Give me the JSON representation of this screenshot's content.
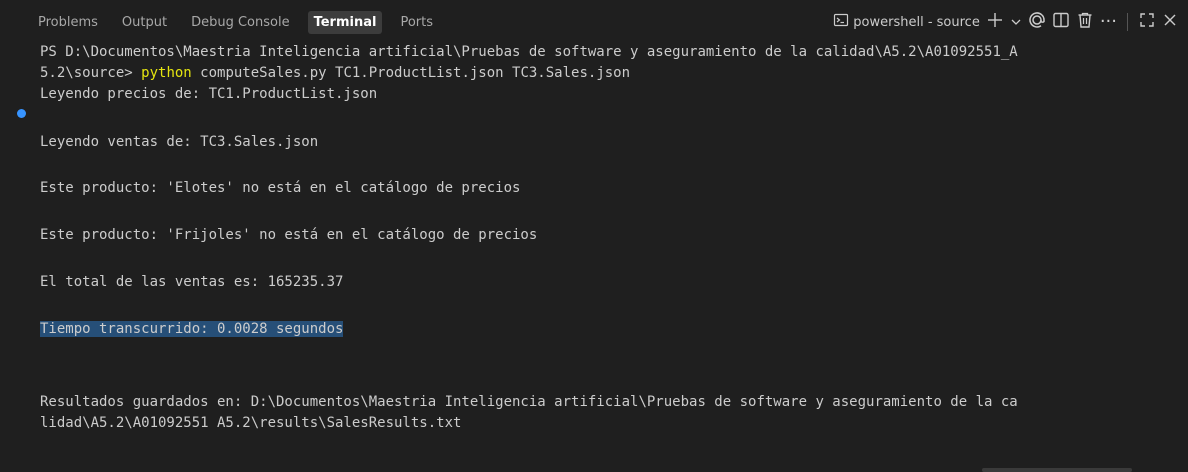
{
  "tabs": [
    {
      "label": "Problems",
      "active": false
    },
    {
      "label": "Output",
      "active": false
    },
    {
      "label": "Debug Console",
      "active": false
    },
    {
      "label": "Terminal",
      "active": true
    },
    {
      "label": "Ports",
      "active": false
    }
  ],
  "toolbar": {
    "terminal_name": "powershell - source",
    "ellipsis": "···",
    "icons": [
      "terminal-icon",
      "plus-icon",
      "chevron-down-icon",
      "copilot-icon",
      "split-icon",
      "trash-icon",
      "more-icon",
      "maximize-icon",
      "close-icon"
    ]
  },
  "terminal": {
    "prompt_line1": "PS D:\\Documentos\\Maestria Inteligencia artificial\\Pruebas de software y aseguramiento de la calidad\\A5.2\\A01092551_A",
    "prompt_line2_prefix": "5.2\\source> ",
    "command_word": "python",
    "command_args": " computeSales.py TC1.ProductList.json TC3.Sales.json",
    "out_prices": "Leyendo precios de: TC1.ProductList.json",
    "out_sales": "Leyendo ventas de: TC3.Sales.json",
    "out_missing1": "Este producto: 'Elotes' no está en el catálogo de precios",
    "out_missing2": "Este producto: 'Frijoles' no está en el catálogo de precios",
    "out_total": "El total de las ventas es: 165235.37",
    "out_time": "Tiempo transcurrido: 0.0028 segundos",
    "out_saved1": "Resultados guardados en: D:\\Documentos\\Maestria Inteligencia artificial\\Pruebas de software y aseguramiento de la ca",
    "out_saved2": "lidad\\A5.2\\A01092551 A5.2\\results\\SalesResults.txt"
  },
  "colors": {
    "background": "#1f1f1f",
    "command": "#e5e510",
    "selection": "#264f78",
    "decoration_dot": "#3794ff"
  }
}
